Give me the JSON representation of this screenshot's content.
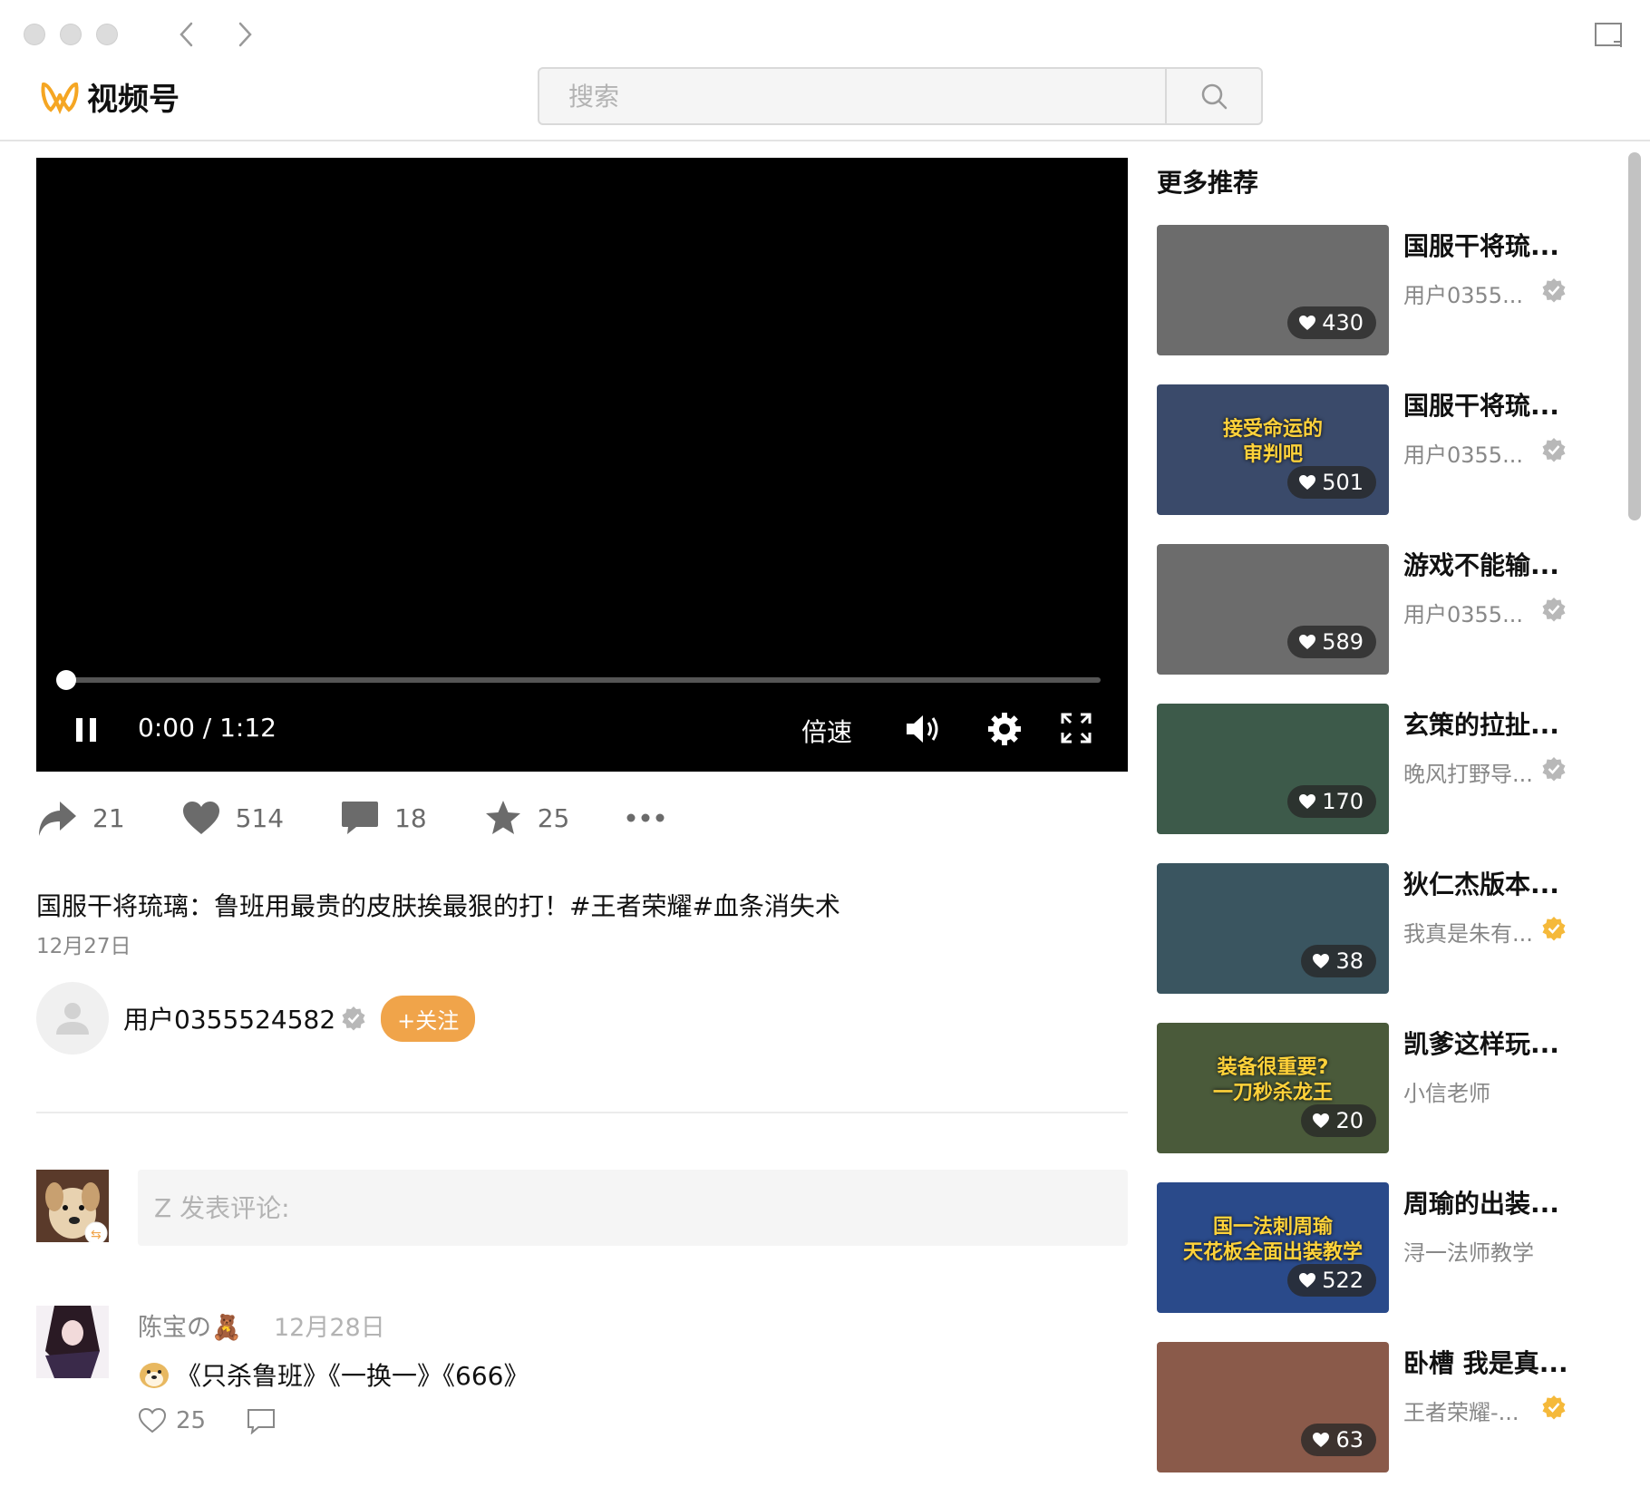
{
  "app": {
    "name": "视频号"
  },
  "search": {
    "placeholder": "搜索"
  },
  "player": {
    "time": "0:00 / 1:12",
    "speed_label": "倍速",
    "progress": 0
  },
  "actions": {
    "share": "21",
    "like": "514",
    "comment": "18",
    "favorite": "25"
  },
  "video": {
    "title": "国服干将琉璃：鲁班用最贵的皮肤挨最狠的打！#王者荣耀#血条消失术",
    "date": "12月27日"
  },
  "author": {
    "name": "用户0355524582",
    "follow_label": "+关注"
  },
  "comment_box": {
    "placeholder": "Z 发表评论:"
  },
  "comments": [
    {
      "name": "陈宝の🧸",
      "date": "12月28日",
      "text": "《只杀鲁班》《一换一》《666》",
      "likes": "25"
    }
  ],
  "sidebar": {
    "heading": "更多推荐",
    "items": [
      {
        "title": "国服干将琉...",
        "author": "用户0355...",
        "likes": "430",
        "verified": "gray",
        "thumb": "#6c6c6c"
      },
      {
        "title": "国服干将琉...",
        "author": "用户0355...",
        "likes": "501",
        "verified": "gray",
        "thumb": "#3a4a6a",
        "thumb_text": [
          "接受命运的",
          "审判吧"
        ]
      },
      {
        "title": "游戏不能输...",
        "author": "用户0355...",
        "likes": "589",
        "verified": "gray",
        "thumb": "#6c6c6c"
      },
      {
        "title": "玄策的拉扯...",
        "author": "晚风打野导...",
        "likes": "170",
        "verified": "gray",
        "thumb": "#3d5a4a"
      },
      {
        "title": "狄仁杰版本...",
        "author": "我真是朱有...",
        "likes": "38",
        "verified": "gold",
        "thumb": "#3a5560"
      },
      {
        "title": "凯爹这样玩...",
        "author": "小信老师",
        "likes": "20",
        "verified": "none",
        "thumb": "#4a5a3a",
        "thumb_text": [
          "装备很重要?",
          "一刀秒杀龙王"
        ]
      },
      {
        "title": "周瑜的出装...",
        "author": "浔一法师教学",
        "likes": "522",
        "verified": "none",
        "thumb": "#2a4a8a",
        "thumb_text": [
          "国一法刺周瑜",
          "天花板全面出装教学"
        ]
      },
      {
        "title": "卧槽 我是真...",
        "author": "王者荣耀-...",
        "likes": "63",
        "verified": "gold",
        "thumb": "#8a5a4a"
      }
    ]
  },
  "colors": {
    "accent": "#f0a44a",
    "verified_gold": "#f5b93a",
    "verified_gray": "#b8b8b8"
  }
}
